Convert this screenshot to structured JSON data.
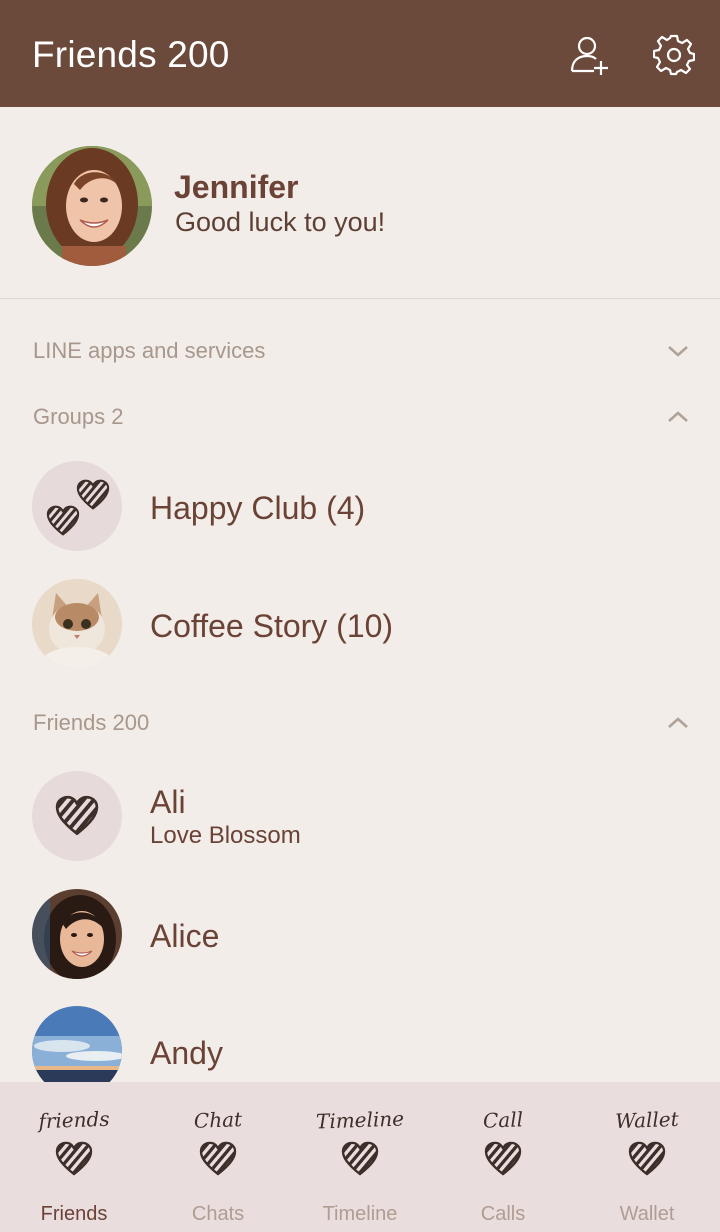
{
  "header": {
    "title": "Friends 200",
    "bg_color": "#6b4a3b",
    "actions": [
      "add-friend-icon",
      "gear-icon"
    ]
  },
  "profile": {
    "name": "Jennifer",
    "status": "Good luck to you!"
  },
  "sections": {
    "apps": {
      "label": "LINE apps and services",
      "expanded": false
    },
    "groups": {
      "label": "Groups 2",
      "expanded": true
    },
    "friends": {
      "label": "Friends 200",
      "expanded": true
    }
  },
  "groups": [
    {
      "name": "Happy Club (4)",
      "avatar": "hearts-icon"
    },
    {
      "name": "Coffee Story (10)",
      "avatar": "cat-photo"
    }
  ],
  "friends": [
    {
      "name": "Ali",
      "status": "Love Blossom",
      "avatar": "heart-icon"
    },
    {
      "name": "Alice",
      "status": "",
      "avatar": "woman-photo"
    },
    {
      "name": "Andy",
      "status": "",
      "avatar": "sky-photo"
    }
  ],
  "tabs": [
    {
      "hand": "friends",
      "label": "Friends",
      "active": true
    },
    {
      "hand": "Chat",
      "label": "Chats",
      "active": false
    },
    {
      "hand": "Timeline",
      "label": "Timeline",
      "active": false
    },
    {
      "hand": "Call",
      "label": "Calls",
      "active": false
    },
    {
      "hand": "Wallet",
      "label": "Wallet",
      "active": false
    }
  ],
  "colors": {
    "accent_text": "#6b4236",
    "background": "#f2ede8",
    "tabbar": "#eaddde",
    "muted": "#a8978c"
  }
}
